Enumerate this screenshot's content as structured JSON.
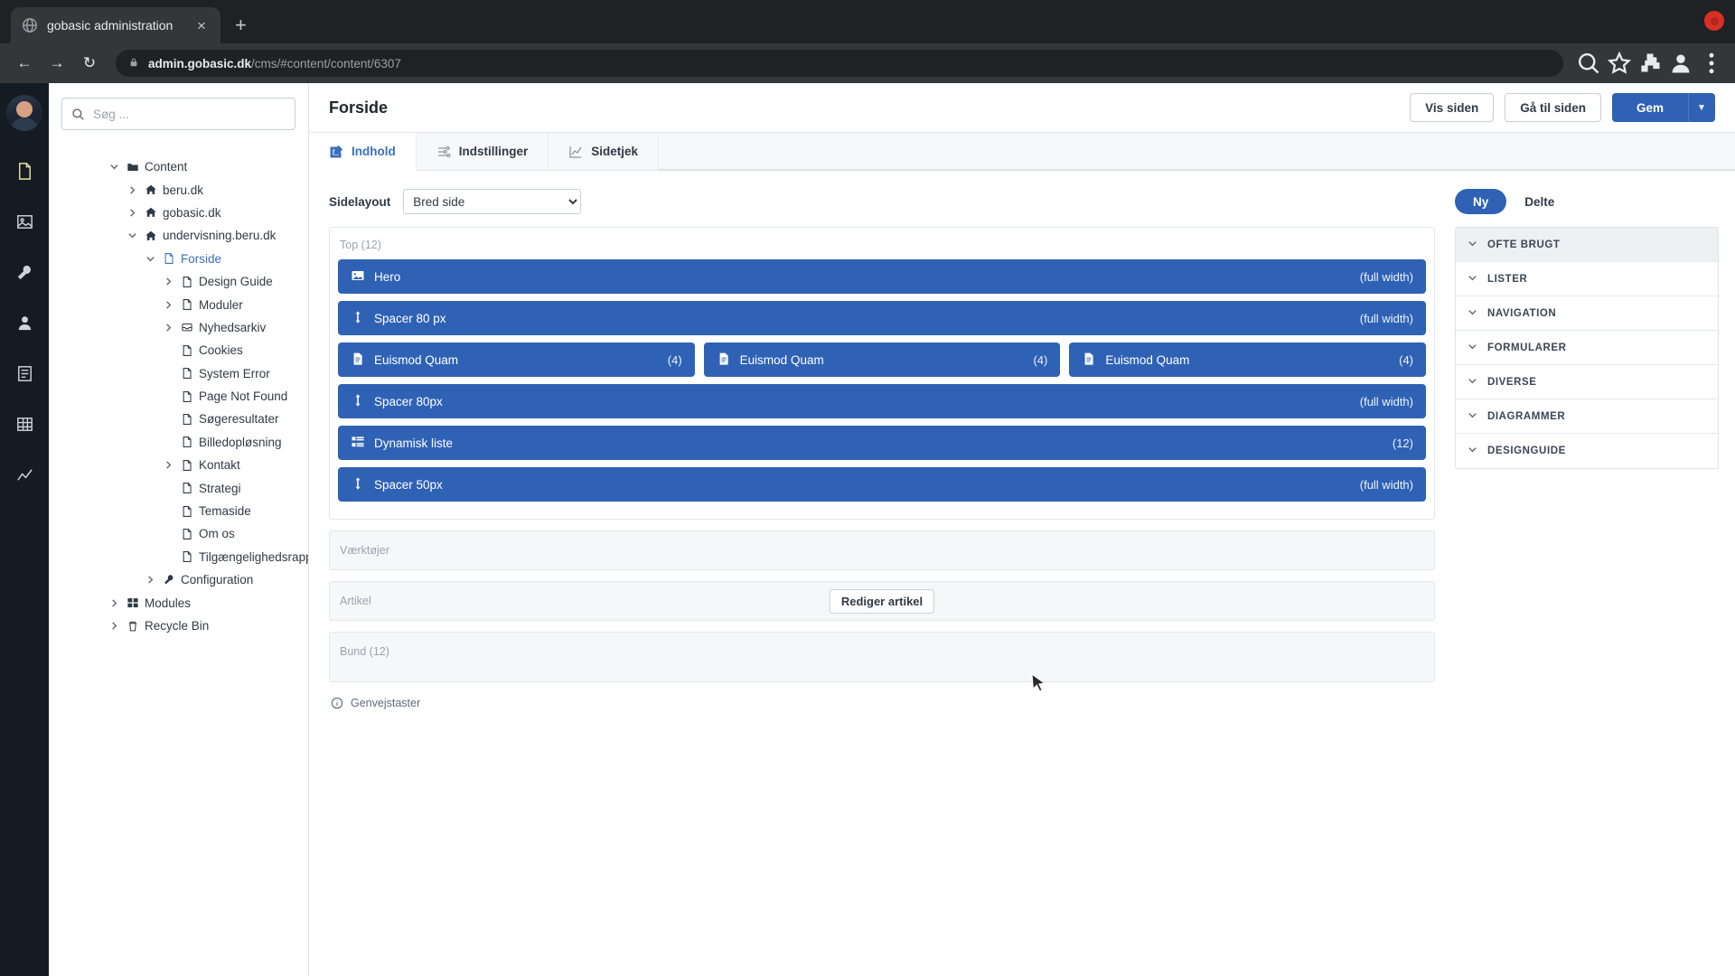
{
  "browser": {
    "tab_title": "gobasic administration",
    "tab_favicon": "globe-icon",
    "close_label": "×",
    "new_tab_label": "+",
    "url_domain": "admin.gobasic.dk",
    "url_path": "/cms/#content/content/6307",
    "back_label": "←",
    "forward_label": "→",
    "reload_label": "↻"
  },
  "rail": {
    "items": [
      {
        "name": "content-icon"
      },
      {
        "name": "media-icon"
      },
      {
        "name": "settings-icon"
      },
      {
        "name": "users-icon"
      },
      {
        "name": "forms-icon"
      },
      {
        "name": "tables-icon"
      },
      {
        "name": "analytics-icon"
      }
    ]
  },
  "sidebar": {
    "search_placeholder": "Søg ...",
    "search_value": "",
    "tree": [
      {
        "label": "Content",
        "depth": 0,
        "icon": "folder",
        "twisty": "down",
        "selected": false
      },
      {
        "label": "beru.dk",
        "depth": 1,
        "icon": "home",
        "twisty": "right",
        "selected": false
      },
      {
        "label": "gobasic.dk",
        "depth": 1,
        "icon": "home",
        "twisty": "right",
        "selected": false
      },
      {
        "label": "undervisning.beru.dk",
        "depth": 1,
        "icon": "home",
        "twisty": "down",
        "selected": false
      },
      {
        "label": "Forside",
        "depth": 2,
        "icon": "doc",
        "twisty": "down",
        "selected": true
      },
      {
        "label": "Design Guide",
        "depth": 3,
        "icon": "doc",
        "twisty": "right",
        "selected": false
      },
      {
        "label": "Moduler",
        "depth": 3,
        "icon": "doc",
        "twisty": "right",
        "selected": false
      },
      {
        "label": "Nyhedsarkiv",
        "depth": 3,
        "icon": "archive",
        "twisty": "right",
        "selected": false
      },
      {
        "label": "Cookies",
        "depth": 3,
        "icon": "doc",
        "twisty": "none",
        "selected": false
      },
      {
        "label": "System Error",
        "depth": 3,
        "icon": "doc",
        "twisty": "none",
        "selected": false
      },
      {
        "label": "Page Not Found",
        "depth": 3,
        "icon": "doc",
        "twisty": "none",
        "selected": false
      },
      {
        "label": "Søgeresultater",
        "depth": 3,
        "icon": "doc",
        "twisty": "none",
        "selected": false
      },
      {
        "label": "Billedopløsning",
        "depth": 3,
        "icon": "doc",
        "twisty": "none",
        "selected": false
      },
      {
        "label": "Kontakt",
        "depth": 3,
        "icon": "doc",
        "twisty": "right",
        "selected": false
      },
      {
        "label": "Strategi",
        "depth": 3,
        "icon": "doc",
        "twisty": "none",
        "selected": false
      },
      {
        "label": "Temaside",
        "depth": 3,
        "icon": "doc",
        "twisty": "none",
        "selected": false
      },
      {
        "label": "Om os",
        "depth": 3,
        "icon": "doc",
        "twisty": "none",
        "selected": false
      },
      {
        "label": "Tilgængelighedsrapporter",
        "depth": 3,
        "icon": "doc",
        "twisty": "none",
        "selected": false
      },
      {
        "label": "Configuration",
        "depth": 2,
        "icon": "wrench",
        "twisty": "right",
        "selected": false
      },
      {
        "label": "Modules",
        "depth": 0,
        "icon": "modules",
        "twisty": "right",
        "selected": false
      },
      {
        "label": "Recycle Bin",
        "depth": 0,
        "icon": "trash",
        "twisty": "right",
        "selected": false
      }
    ]
  },
  "header": {
    "title": "Forside",
    "view_page_label": "Vis siden",
    "goto_page_label": "Gå til siden",
    "save_label": "Gem",
    "save_caret": "▼"
  },
  "tabs": [
    {
      "label": "Indhold",
      "icon": "edit-icon",
      "active": true
    },
    {
      "label": "Indstillinger",
      "icon": "sliders-icon",
      "active": false
    },
    {
      "label": "Sidetjek",
      "icon": "chart-icon",
      "active": false
    }
  ],
  "editor": {
    "layout_label": "Sidelayout",
    "layout_value": "Bred side",
    "layout_options": [
      "Bred side"
    ],
    "top_zone_label": "Top (12)",
    "blocks": [
      [
        {
          "name": "Hero",
          "icon": "image-icon",
          "meta": "(full width)"
        }
      ],
      [
        {
          "name": "Spacer 80 px",
          "icon": "spacer-icon",
          "meta": "(full width)"
        }
      ],
      [
        {
          "name": "Euismod Quam",
          "icon": "doc-icon",
          "meta": "(4)"
        },
        {
          "name": "Euismod Quam",
          "icon": "doc-icon",
          "meta": "(4)"
        },
        {
          "name": "Euismod Quam",
          "icon": "doc-icon",
          "meta": "(4)"
        }
      ],
      [
        {
          "name": "Spacer 80px",
          "icon": "spacer-icon",
          "meta": "(full width)"
        }
      ],
      [
        {
          "name": "Dynamisk liste",
          "icon": "list-icon",
          "meta": "(12)"
        }
      ],
      [
        {
          "name": "Spacer 50px",
          "icon": "spacer-icon",
          "meta": "(full width)"
        }
      ]
    ],
    "tools_zone_label": "Værktøjer",
    "article_zone_label": "Artikel",
    "edit_article_label": "Rediger artikel",
    "bottom_zone_label": "Bund (12)",
    "shortcuts_label": "Genvejstaster",
    "shortcuts_icon": "info-icon"
  },
  "rightpanel": {
    "new_label": "Ny",
    "shared_label": "Delte",
    "sections": [
      {
        "label": "OFTE BRUGT",
        "shaded": true
      },
      {
        "label": "LISTER",
        "shaded": false
      },
      {
        "label": "NAVIGATION",
        "shaded": false
      },
      {
        "label": "FORMULARER",
        "shaded": false
      },
      {
        "label": "DIVERSE",
        "shaded": false
      },
      {
        "label": "DIAGRAMMER",
        "shaded": false
      },
      {
        "label": "DESIGNGUIDE",
        "shaded": false
      }
    ]
  },
  "colors": {
    "accent": "#2f62b5",
    "rail_bg": "#151b23",
    "chrome_bg": "#202124"
  }
}
